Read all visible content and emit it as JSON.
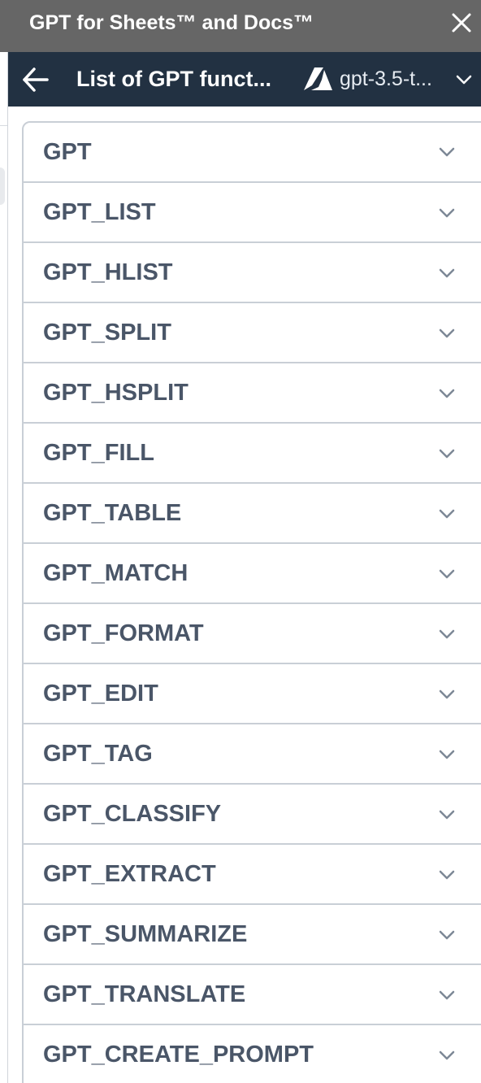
{
  "window": {
    "title": "GPT for Sheets™ and Docs™",
    "close_icon": "close-icon"
  },
  "header": {
    "title": "List of GPT funct...",
    "back_icon": "back-arrow-icon",
    "model": {
      "icon": "azure-icon",
      "name": "gpt-3.5-t...",
      "chevron_icon": "chevron-down-icon"
    },
    "background": "#223142"
  },
  "functions": {
    "items": [
      {
        "label": "GPT"
      },
      {
        "label": "GPT_LIST"
      },
      {
        "label": "GPT_HLIST"
      },
      {
        "label": "GPT_SPLIT"
      },
      {
        "label": "GPT_HSPLIT"
      },
      {
        "label": "GPT_FILL"
      },
      {
        "label": "GPT_TABLE"
      },
      {
        "label": "GPT_MATCH"
      },
      {
        "label": "GPT_FORMAT"
      },
      {
        "label": "GPT_EDIT"
      },
      {
        "label": "GPT_TAG"
      },
      {
        "label": "GPT_CLASSIFY"
      },
      {
        "label": "GPT_EXTRACT"
      },
      {
        "label": "GPT_SUMMARIZE"
      },
      {
        "label": "GPT_TRANSLATE"
      },
      {
        "label": "GPT_CREATE_PROMPT"
      }
    ],
    "item_icon": "chevron-down-icon"
  },
  "colors": {
    "titlebar": "#666666",
    "header": "#223142",
    "item_text": "#4a5668",
    "border": "#c9cfd6"
  }
}
